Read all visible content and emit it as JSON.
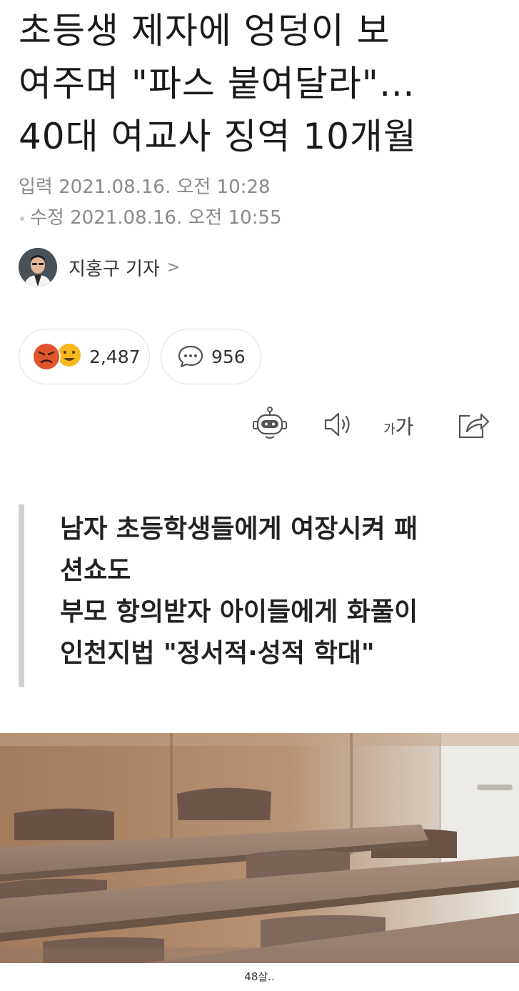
{
  "article": {
    "headline_lines": [
      "초등생 제자에 엉덩이 보",
      "여주며 \"파스 붙여달라\"…",
      "40대 여교사 징역 10개월"
    ],
    "input_time": "입력 2021.08.16. 오전 10:28",
    "edit_time": "수정 2021.08.16. 오전 10:55",
    "reporter": "지홍구 기자",
    "reporter_chevron": ">",
    "reactions_count": "2,487",
    "comments_count": "956",
    "text_size_small": "가",
    "text_size_big": "가",
    "summary_lines": [
      "남자 초등학생들에게 여장시켜 패",
      "션쇼도",
      "부모 항의받자 아이들에게 화풀이",
      "인천지법 \"정서적·성적 학대\""
    ]
  },
  "caption": "48살..",
  "icons": {
    "reactions": [
      "angry-face-icon",
      "laughing-face-icon"
    ],
    "comment": "speech-bubble-icon",
    "toolbar": [
      "robot-summary-icon",
      "speaker-icon",
      "text-size-icon",
      "share-icon"
    ]
  },
  "colors": {
    "angry": "#e0552d",
    "laugh": "#f6b81c",
    "accent_bar": "#cfcfcf"
  }
}
